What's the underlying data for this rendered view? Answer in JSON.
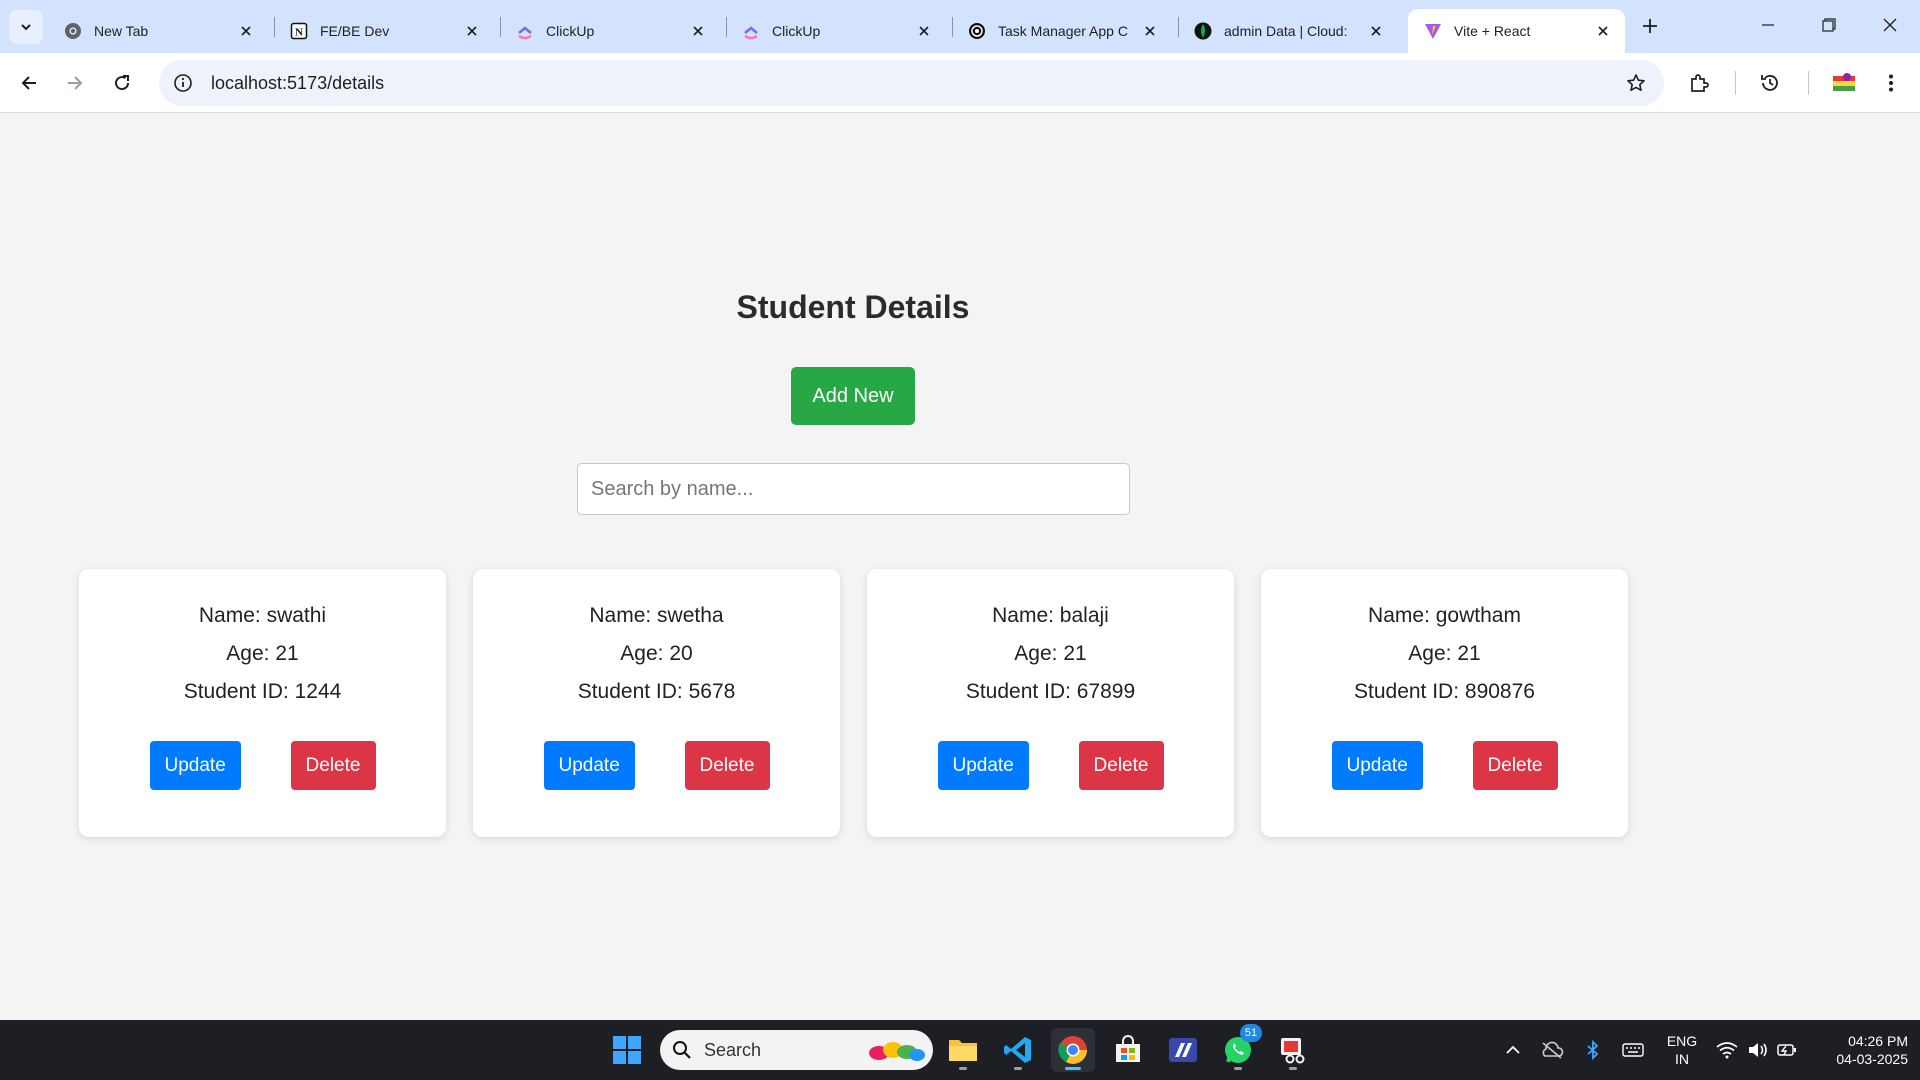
{
  "browser": {
    "tabs": [
      {
        "title": "New Tab",
        "icon": "chrome-icon"
      },
      {
        "title": "FE/BE Dev",
        "icon": "notion-icon"
      },
      {
        "title": "ClickUp",
        "icon": "clickup-icon"
      },
      {
        "title": "ClickUp",
        "icon": "clickup-icon"
      },
      {
        "title": "Task Manager App C",
        "icon": "openai-icon"
      },
      {
        "title": "admin Data | Cloud: ",
        "icon": "mongodb-icon"
      },
      {
        "title": "Vite + React",
        "icon": "vite-icon"
      }
    ],
    "url": "localhost:5173/details"
  },
  "page": {
    "title": "Student Details",
    "add_button": "Add New",
    "search_placeholder": "Search by name...",
    "students": [
      {
        "name": "Name: swathi",
        "age": "Age: 21",
        "id": "Student ID: 1244"
      },
      {
        "name": "Name: swetha",
        "age": "Age: 20",
        "id": "Student ID: 5678"
      },
      {
        "name": "Name: balaji",
        "age": "Age: 21",
        "id": "Student ID: 67899"
      },
      {
        "name": "Name: gowtham",
        "age": "Age: 21",
        "id": "Student ID: 890876"
      }
    ],
    "update_label": "Update",
    "delete_label": "Delete"
  },
  "taskbar": {
    "search_label": "Search",
    "whatsapp_badge": "51",
    "lang_line1": "ENG",
    "lang_line2": "IN",
    "time": "04:26 PM",
    "date": "04-03-2025"
  },
  "colors": {
    "add": "#28a745",
    "update": "#007bff",
    "delete": "#dc3545"
  }
}
